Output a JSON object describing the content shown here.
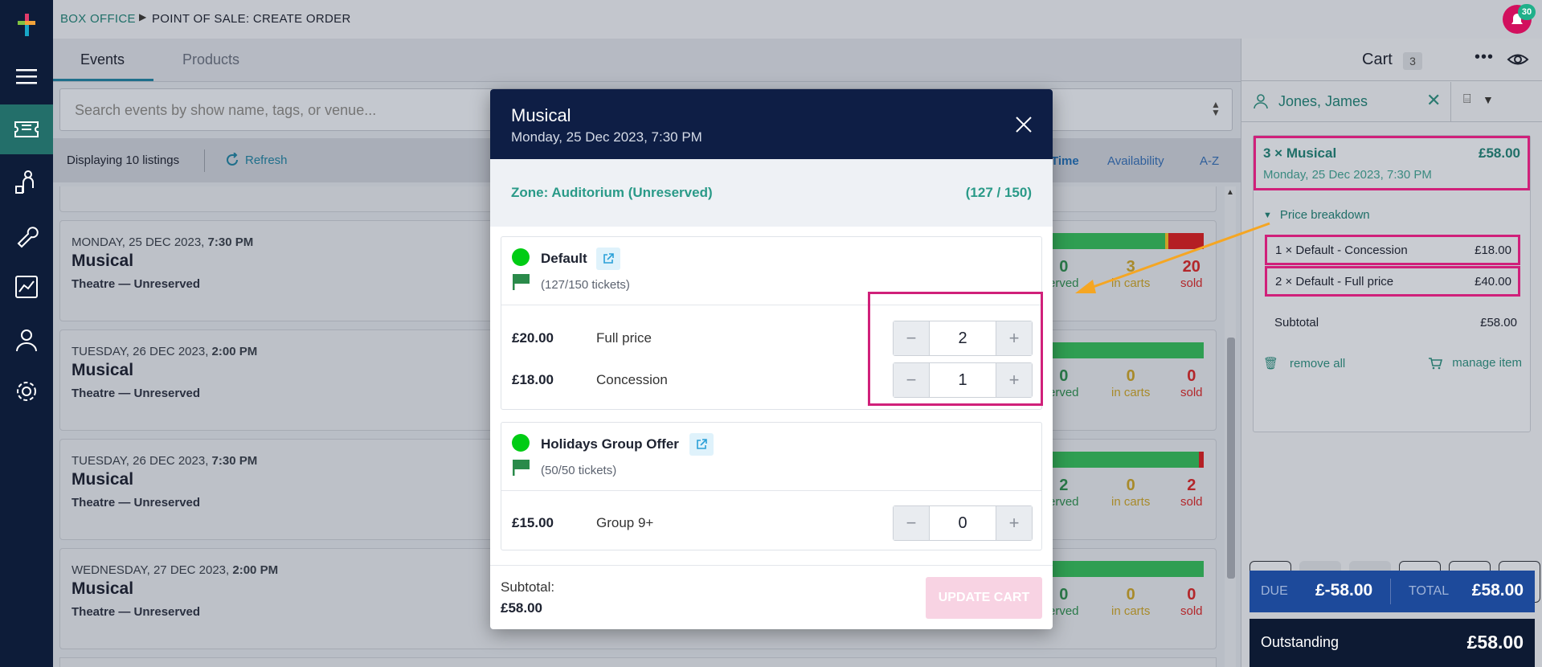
{
  "breadcrumb": {
    "parent": "BOX OFFICE",
    "current": "POINT OF SALE: CREATE ORDER"
  },
  "notification": {
    "count": "30"
  },
  "tabs": [
    {
      "label": "Events"
    },
    {
      "label": "Products"
    }
  ],
  "search": {
    "placeholder": "Search events by show name, tags, or venue..."
  },
  "toolbar": {
    "count_text": "Displaying 10 listings",
    "refresh_label": "Refresh",
    "sort_options": [
      "Time",
      "Availability",
      "A-Z"
    ],
    "selected_sort": "Time"
  },
  "listings": [
    {
      "date_prefix": "MONDAY, 25 DEC 2023, ",
      "time": "7:30 PM",
      "title": "Musical",
      "venue": "Theatre — Unreserved",
      "reserved": "0",
      "reserved_label": "erved",
      "in_carts": "3",
      "in_carts_label": "in carts",
      "sold": "20",
      "sold_label": "sold"
    },
    {
      "date_prefix": "TUESDAY, 26 DEC 2023, ",
      "time": "2:00 PM",
      "title": "Musical",
      "venue": "Theatre — Unreserved",
      "reserved": "0",
      "reserved_label": "erved",
      "in_carts": "0",
      "in_carts_label": "in carts",
      "sold": "0",
      "sold_label": "sold"
    },
    {
      "date_prefix": "TUESDAY, 26 DEC 2023, ",
      "time": "7:30 PM",
      "title": "Musical",
      "venue": "Theatre — Unreserved",
      "reserved": "2",
      "reserved_label": "erved",
      "in_carts": "0",
      "in_carts_label": "in carts",
      "sold": "2",
      "sold_label": "sold"
    },
    {
      "date_prefix": "WEDNESDAY, 27 DEC 2023, ",
      "time": "2:00 PM",
      "title": "Musical",
      "venue": "Theatre — Unreserved",
      "reserved": "0",
      "reserved_label": "erved",
      "in_carts": "0",
      "in_carts_label": "in carts",
      "sold": "0",
      "sold_label": "sold"
    }
  ],
  "cart": {
    "title": "Cart",
    "count": "3",
    "customer": "Jones, James",
    "item": {
      "title": "3 × Musical",
      "price": "£58.00",
      "date": "Monday, 25 Dec 2023, 7:30 PM"
    },
    "breakdown_label": "Price breakdown",
    "lines": [
      {
        "label": "1 × Default - Concession",
        "price": "£18.00"
      },
      {
        "label": "2 × Default - Full price",
        "price": "£40.00"
      }
    ],
    "subtotal_label": "Subtotal",
    "subtotal": "£58.00",
    "remove_all": "remove all",
    "manage_item": "manage item",
    "due_label": "DUE",
    "due": "£-58.00",
    "total_label": "TOTAL",
    "total": "£58.00",
    "outstanding_label": "Outstanding",
    "outstanding": "£58.00"
  },
  "modal": {
    "title": "Musical",
    "subtitle": "Monday, 25 Dec 2023, 7:30 PM",
    "zone": "Zone: Auditorium (Unreserved)",
    "zone_capacity": "(127 / 150)",
    "offers": [
      {
        "name": "Default",
        "tickets": "(127/150 tickets)",
        "prices": [
          {
            "amount": "£20.00",
            "label": "Full price",
            "qty": "2"
          },
          {
            "amount": "£18.00",
            "label": "Concession",
            "qty": "1"
          }
        ]
      },
      {
        "name": "Holidays Group Offer",
        "tickets": "(50/50 tickets)",
        "prices": [
          {
            "amount": "£15.00",
            "label": "Group 9+",
            "qty": "0"
          }
        ]
      }
    ],
    "subtotal_label": "Subtotal:",
    "subtotal": "£58.00",
    "update_button": "UPDATE CART"
  },
  "colors": {
    "accent": "#1f8f87",
    "navy": "#0e1e45",
    "highlight": "#d0207a",
    "sold": "#c62828",
    "in_carts": "#c9a227",
    "annotation_arrow": "#f5a623"
  }
}
